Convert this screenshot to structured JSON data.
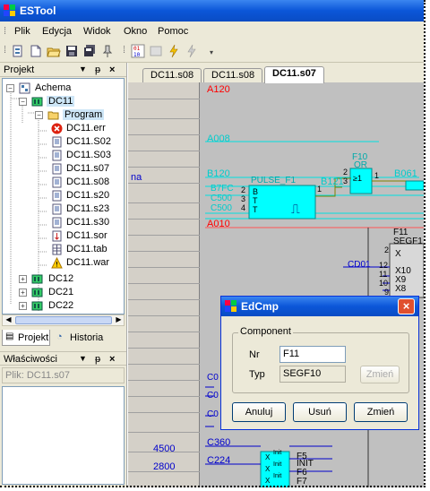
{
  "app": {
    "title": "ESTool"
  },
  "menu": [
    "Plik",
    "Edycja",
    "Widok",
    "Okno",
    "Pomoc"
  ],
  "project_panel": {
    "title": "Projekt",
    "tree": [
      {
        "label": "Achema",
        "icon": "project-icon"
      },
      {
        "label": "DC11",
        "icon": "controller-icon",
        "selected": true
      },
      {
        "label": "Program",
        "icon": "folder-open-icon",
        "selected": true
      },
      {
        "label": "DC11.err",
        "icon": "error-icon"
      },
      {
        "label": "DC11.S02",
        "icon": "program-file-icon"
      },
      {
        "label": "DC11.S03",
        "icon": "program-file-icon"
      },
      {
        "label": "DC11.s07",
        "icon": "program-file-icon"
      },
      {
        "label": "DC11.s08",
        "icon": "program-file-icon"
      },
      {
        "label": "DC11.s20",
        "icon": "program-file-icon"
      },
      {
        "label": "DC11.s23",
        "icon": "program-file-icon"
      },
      {
        "label": "DC11.s30",
        "icon": "program-file-icon"
      },
      {
        "label": "DC11.sor",
        "icon": "sort-file-icon"
      },
      {
        "label": "DC11.tab",
        "icon": "table-file-icon"
      },
      {
        "label": "DC11.war",
        "icon": "warning-icon"
      },
      {
        "label": "DC12",
        "icon": "controller-icon"
      },
      {
        "label": "DC21",
        "icon": "controller-icon"
      },
      {
        "label": "DC22",
        "icon": "controller-icon"
      }
    ],
    "bottom_tabs": [
      "Projekt",
      "Historia"
    ]
  },
  "properties_panel": {
    "title": "Właściwości",
    "field": "Plik: DC11.s07"
  },
  "editor": {
    "tabs": [
      "DC11.s08",
      "DC11.s08",
      "DC11.s07"
    ],
    "active_tab": 2,
    "row_labels": [
      "na",
      "4500",
      "2800"
    ],
    "signals": {
      "a120": "A120",
      "a008": "A008",
      "b120": "B120",
      "b061": "B061",
      "b121": "B121",
      "a010": "A010",
      "b7fc": "B7FC",
      "c500a": "C500",
      "c500b": "C500",
      "cd01": "CD01",
      "c360": "C360",
      "c224": "C224",
      "c0a": "C0",
      "c0b": "C0",
      "c0c": "C0"
    },
    "blocks": {
      "pulse": "PULSE_F1",
      "pulse_pins": [
        "B",
        "T",
        "T"
      ],
      "pulse_pin_nums": [
        "2",
        "3",
        "4"
      ],
      "pulse_out": "1",
      "pulse_glyph": "⎍",
      "or_name": "F10",
      "or_type": "OR",
      "or_symbol": "≥1",
      "or_pin_nums": [
        "2",
        "3"
      ],
      "or_out": "1",
      "segf_name": "F11",
      "segf_type": "SEGF1",
      "segf_pins": [
        "X",
        "X10",
        "X9",
        "X8"
      ],
      "segf_nums": [
        "2",
        "12",
        "11",
        "10",
        "9"
      ],
      "f5": "F5",
      "f6": "F6",
      "f7": "F7",
      "init": "INIT",
      "init_labels": [
        "Init",
        "Init",
        "Init"
      ],
      "x_labels": [
        "X",
        "X",
        "X"
      ]
    }
  },
  "dialog": {
    "title": "EdCmp",
    "group": "Component",
    "nr_label": "Nr",
    "nr_value": "F11",
    "typ_label": "Typ",
    "typ_value": "SEGF10",
    "zmien_small": "Zmień",
    "buttons": [
      "Anuluj",
      "Usuń",
      "Zmień"
    ]
  },
  "colors": {
    "signal": "#ff0000",
    "line_cyan": "#00e0e0",
    "block_fill": "#00ffff",
    "wire_blue": "#0000cc",
    "wire_olive": "#808000"
  }
}
